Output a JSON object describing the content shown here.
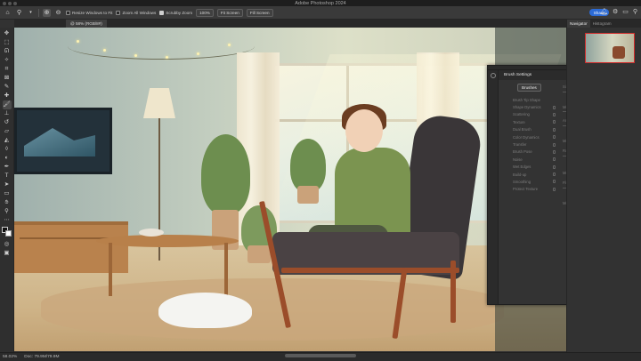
{
  "window": {
    "title": "Adobe Photoshop 2024"
  },
  "options_bar": {
    "zoom_in_icon": "zoom-in-icon",
    "zoom_out_icon": "zoom-out-icon",
    "resize_windows_label": "Resize Windows to Fit",
    "resize_windows_checked": false,
    "zoom_all_label": "Zoom All Windows",
    "zoom_all_checked": false,
    "scrubby_zoom_label": "Scrubby Zoom",
    "scrubby_zoom_checked": true,
    "zoom_level_button": "100%",
    "fit_screen_button": "Fit Screen",
    "fill_screen_button": "Fill Screen",
    "share_button": "Share"
  },
  "document": {
    "tab_label": "@ 58% (RGB/8#)"
  },
  "brush_settings": {
    "title": "Brush Settings",
    "brushes_button": "Brushes",
    "options": [
      "Brush Tip Shape",
      "Shape Dynamics",
      "Scattering",
      "Texture",
      "Dual Brush",
      "Color Dynamics",
      "Transfer",
      "Brush Pose",
      "Noise",
      "Wet Edges",
      "Build-up",
      "Smoothing",
      "Protect Texture"
    ],
    "controls": {
      "size_jitter": "Size Jitter",
      "control": "Control:",
      "off": "Off",
      "minimum": "Minimum",
      "angle_jitter": "Angle Jitter",
      "roundness_jitter": "Roundness Jitter",
      "flip_x_jitter": "Flip X Jitter"
    }
  },
  "right_panel": {
    "tabs": [
      "Navigator",
      "Histogram"
    ]
  },
  "status": {
    "zoom": "58.02%",
    "doc": "Doc: 79.9M/79.9M"
  },
  "colors": {
    "accent": "#2c6bd6",
    "panel": "#333333",
    "ui_dark": "#2b2b2b"
  }
}
